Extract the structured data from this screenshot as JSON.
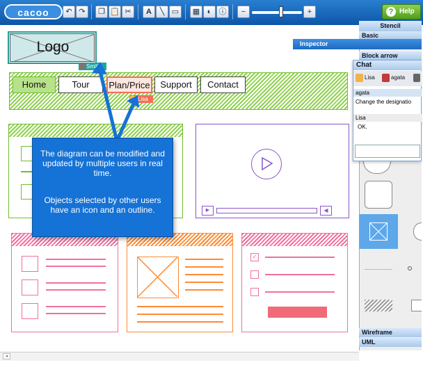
{
  "app": {
    "logo_text": "cacoo"
  },
  "toolbar": {
    "help_label": "Help",
    "buttons": [
      "undo",
      "redo",
      "copy",
      "paste",
      "cut",
      "text",
      "line",
      "image",
      "layout",
      "color",
      "info",
      "zoom-out",
      "zoom-in"
    ]
  },
  "canvas": {
    "logo_label": "Logo",
    "nav": [
      "Home",
      "Tour",
      "Plan/Price",
      "Support",
      "Contact"
    ],
    "user_tags": {
      "smith": "Smith",
      "lisa": "Lisa"
    },
    "tooltip": {
      "line1": "The diagram can be modified and updated by multiple users in real time.",
      "line2": "Objects selected by other users have an icon and an outline."
    }
  },
  "stencil": {
    "title": "Stencil",
    "basic": "Basic",
    "block_arrow": "Block arrow",
    "wireframe": "Wireframe",
    "uml": "UML"
  },
  "inspector": {
    "title": "Inspector"
  },
  "chat": {
    "title": "Chat",
    "users": [
      "Lisa",
      "agata"
    ],
    "messages": [
      {
        "author": "agata",
        "text": "Change the designatio"
      },
      {
        "author": "Lisa",
        "text": "OK."
      }
    ]
  },
  "colors": {
    "toolbar": "#0d55a8",
    "accent_blue": "#1572d6",
    "green": "#6fbf2f",
    "pink": "#f070a0",
    "orange": "#ff8a33",
    "purple": "#8a55c8",
    "selection_teal": "#1aa8a0"
  }
}
